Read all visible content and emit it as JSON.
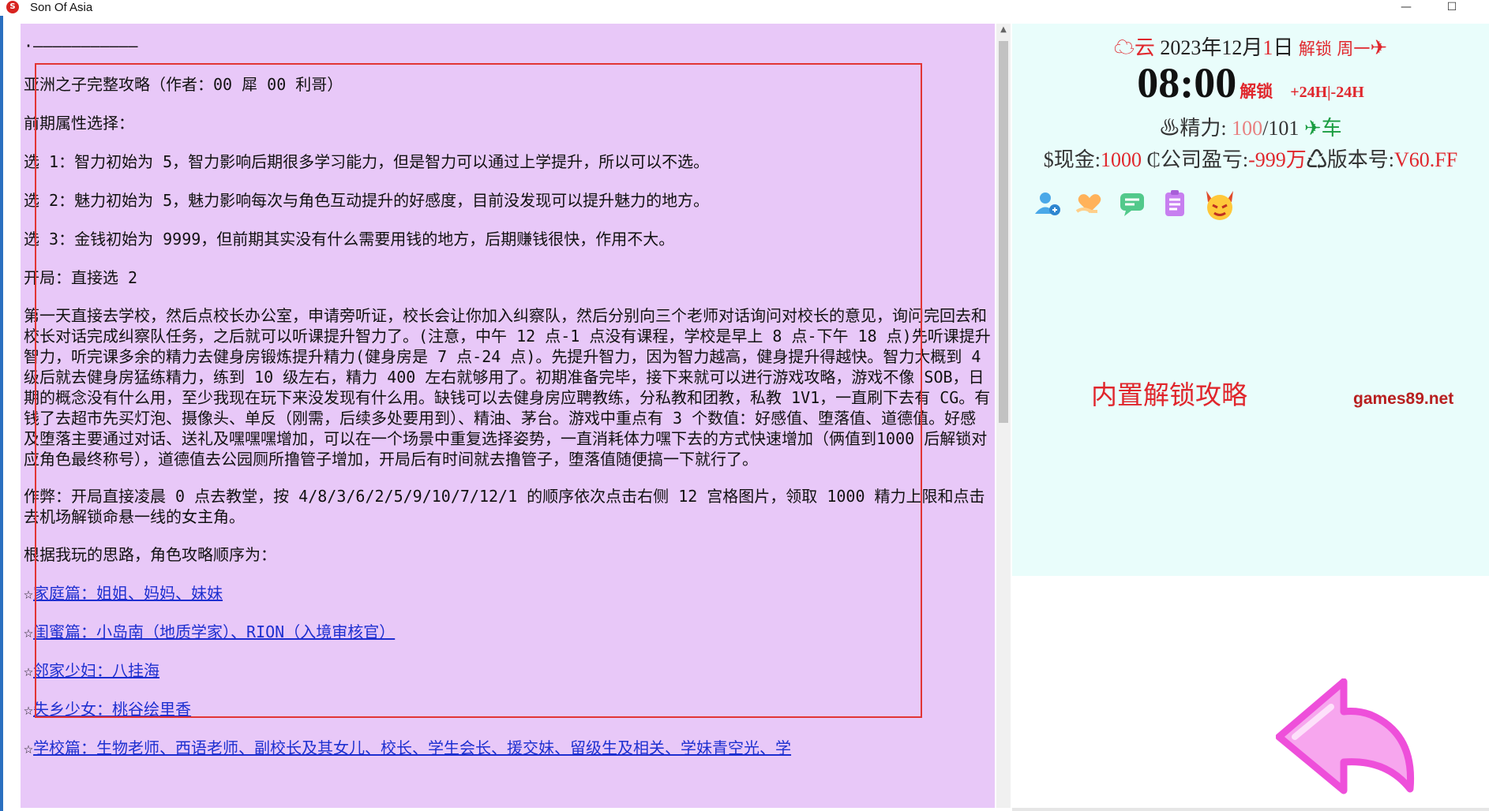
{
  "window": {
    "title": "Son Of Asia",
    "minimize_glyph": "—",
    "maximize_glyph": "☐"
  },
  "guide": {
    "divider": "·———————————",
    "heading": "亚洲之子完整攻略（作者：00 犀 00 利哥）",
    "attr_title": "前期属性选择：",
    "option1": "选 1：智力初始为 5，智力影响后期很多学习能力，但是智力可以通过上学提升，所以可以不选。",
    "option2": "选 2：魅力初始为 5，魅力影响每次与角色互动提升的好感度，目前没发现可以提升魅力的地方。",
    "option3": "选 3：金钱初始为 9999，但前期其实没有什么需要用钱的地方，后期赚钱很快，作用不大。",
    "opening": "开局：直接选 2",
    "para_day1": "第一天直接去学校，然后点校长办公室，申请旁听证，校长会让你加入纠察队，然后分别向三个老师对话询问对校长的意见，询问完回去和校长对话完成纠察队任务，之后就可以听课提升智力了。(注意，中午 12 点-1 点没有课程，学校是早上 8 点-下午 18 点)先听课提升智力，听完课多余的精力去健身房锻炼提升精力(健身房是 7 点-24 点)。先提升智力，因为智力越高，健身提升得越快。智力大概到 4 级后就去健身房猛练精力，练到 10 级左右，精力 400 左右就够用了。初期准备完毕，接下来就可以进行游戏攻略，游戏不像 SOB，日期的概念没有什么用，至少我现在玩下来没发现有什么用。缺钱可以去健身房应聘教练，分私教和团教，私教 1V1，一直刷下去有 CG。有钱了去超市先买灯泡、摄像头、单反（刚需，后续多处要用到）、精油、茅台。游戏中重点有 3 个数值：好感值、堕落值、道德值。好感及堕落主要通过对话、送礼及嘿嘿嘿增加，可以在一个场景中重复选择姿势，一直消耗体力嘿下去的方式快速增加（俩值到1000 后解锁对应角色最终称号），道德值去公园厕所撸管子增加，开局后有时间就去撸管子，堕落值随便搞一下就行了。",
    "cheat": "作弊：开局直接凌晨 0 点去教堂，按 4/8/3/6/2/5/9/10/7/12/1 的顺序依次点击右侧 12 宫格图片，领取 1000 精力上限和点击去机场解锁命悬一线的女主角。",
    "order_intro": "根据我玩的思路，角色攻略顺序为：",
    "star": "☆",
    "links": [
      "家庭篇：姐姐、妈妈、妹妹",
      "闺蜜篇：小岛南（地质学家）、RION（入境审核官）",
      "邻家少妇：八挂海",
      "失乡少女：桃谷绘里香",
      "学校篇：生物老师、西语老师、副校长及其女儿、校长、学生会长、援交妹、留级生及相关、学妹青空光、学"
    ]
  },
  "status": {
    "weather_icon": "cloud-icon",
    "weather": "云",
    "year": "2023年",
    "month": "12月",
    "day_num": "1",
    "day_char": "日",
    "date_unlock": "解锁",
    "weekday": "周一",
    "weekday_arrow": "✈",
    "time": "08:00",
    "time_unlock": "解锁",
    "time_adjust": "+24H|-24H",
    "energy_label": "♨精力:",
    "energy_current": "100",
    "energy_sep": "/",
    "energy_max": "101",
    "energy_plane": "✈",
    "energy_car": "车",
    "cash_label": "$现金:",
    "cash_value": "1000",
    "company_label": "₵公司盈亏:",
    "company_value": "-999万",
    "version_label": "♺版本号:",
    "version_value": "V60.FF",
    "icons": [
      "user-add-icon",
      "heart-hand-icon",
      "chat-icon",
      "notes-icon",
      "devil-icon"
    ],
    "colors": {
      "accent_red": "#e0262c",
      "panel_bg": "#e9fdfb",
      "guide_bg": "#e8c8f8",
      "arrow_pink": "#f06fe0"
    }
  },
  "overlay": {
    "promo_text": "内置解锁攻略",
    "watermark": "games89.net"
  }
}
